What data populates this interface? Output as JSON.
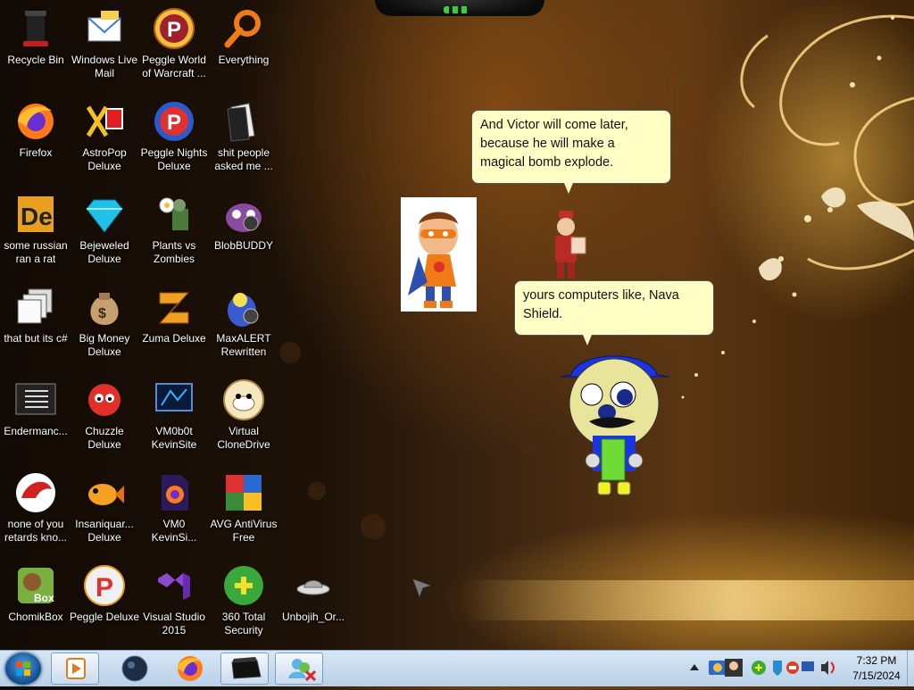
{
  "desktop": {
    "icons": [
      {
        "label": "Recycle Bin",
        "icon": "recycle-bin-icon"
      },
      {
        "label": "Windows Live\nMail",
        "icon": "windows-live-mail-icon"
      },
      {
        "label": "Peggle World\nof Warcraft ...",
        "icon": "peggle-wow-icon"
      },
      {
        "label": "Everything",
        "icon": "everything-search-icon"
      },
      {
        "label": "Firefox",
        "icon": "firefox-icon"
      },
      {
        "label": "AstroPop\nDeluxe",
        "icon": "astropop-icon"
      },
      {
        "label": "Peggle Nights\nDeluxe",
        "icon": "peggle-nights-icon"
      },
      {
        "label": "shit people\nasked me ...",
        "icon": "folder-icon"
      },
      {
        "label": "some russian\nran a rat",
        "icon": "de-app-icon"
      },
      {
        "label": "Bejeweled\nDeluxe",
        "icon": "bejeweled-icon"
      },
      {
        "label": "Plants vs\nZombies",
        "icon": "plants-vs-zombies-icon"
      },
      {
        "label": "BlobBUDDY",
        "icon": "blobbuddy-icon"
      },
      {
        "label": "that but its c#",
        "icon": "copy-windows-icon"
      },
      {
        "label": "Big Money\nDeluxe",
        "icon": "money-bag-icon"
      },
      {
        "label": "Zuma Deluxe",
        "icon": "zuma-icon"
      },
      {
        "label": "MaxALERT\nRewritten",
        "icon": "maxalert-icon"
      },
      {
        "label": "Endermanc...",
        "icon": "console-window-icon"
      },
      {
        "label": "Chuzzle\nDeluxe",
        "icon": "chuzzle-icon"
      },
      {
        "label": "VM0b0t\nKevinSite",
        "icon": "vm-monitor-icon"
      },
      {
        "label": "Virtual\nCloneDrive",
        "icon": "clonedrive-sheep-icon"
      },
      {
        "label": "none of you\nretards kno...",
        "icon": "red-dragon-icon"
      },
      {
        "label": "Insaniquar...\nDeluxe",
        "icon": "insaniquarium-fish-icon"
      },
      {
        "label": "VM0\nKevinSi...",
        "icon": "firefox-file-icon"
      },
      {
        "label": "AVG AntiVirus\nFree",
        "icon": "avg-antivirus-icon"
      },
      {
        "label": "ChomikBox",
        "icon": "chomikbox-icon"
      },
      {
        "label": "Peggle Deluxe",
        "icon": "peggle-deluxe-icon"
      },
      {
        "label": "Visual Studio\n2015",
        "icon": "visual-studio-icon"
      },
      {
        "label": "360 Total\nSecurity",
        "icon": "360-security-icon"
      },
      {
        "label": "Unbojih_Or...",
        "icon": "ufo-icon"
      }
    ]
  },
  "scene": {
    "bubble_top": "And Victor will come later,\nbecause he will make a\nmagical bomb explode.",
    "bubble_bottom": "yours computers like, Nava\nShield."
  },
  "taskbar": {
    "buttons": [
      {
        "icon": "media-player-icon"
      },
      {
        "icon": "dark-orb-icon"
      },
      {
        "icon": "firefox-icon"
      },
      {
        "icon": "black-box-icon"
      },
      {
        "icon": "messenger-error-icon"
      }
    ],
    "tray_icons": [
      "network-icon",
      "avatar-tray-icon",
      "update-icon",
      "shield-tray-icon",
      "record-icon",
      "monitor-tray-icon",
      "volume-icon"
    ],
    "clock_time": "7:32 PM",
    "clock_date": "7/15/2024"
  },
  "colors": {
    "bubble_fill": "#fffec4",
    "taskbar_top": "#d7e6f4",
    "taskbar_bottom": "#b9d0e8"
  }
}
